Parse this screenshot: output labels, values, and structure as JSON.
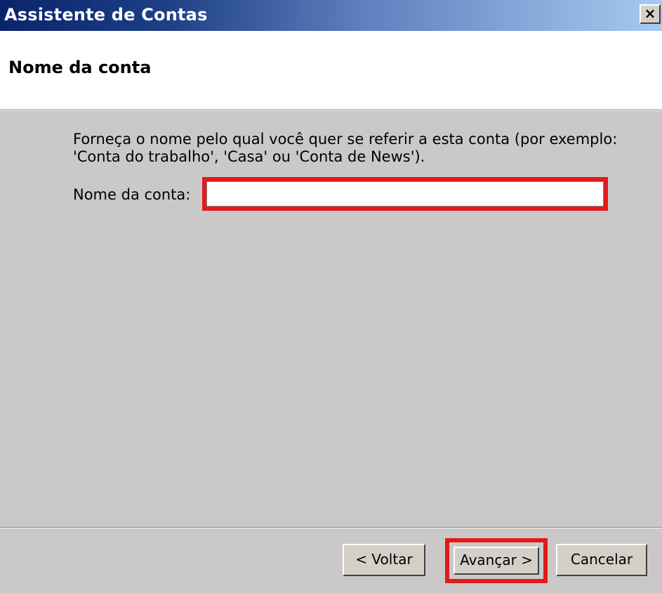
{
  "window": {
    "title": "Assistente de Contas",
    "close_symbol": "×"
  },
  "header": {
    "title": "Nome da conta"
  },
  "content": {
    "description": "Forneça o nome pelo qual você quer se referir a esta conta (por exemplo: 'Conta do trabalho', 'Casa' ou 'Conta de News').",
    "field_label": "Nome da conta:",
    "field_value": ""
  },
  "buttons": {
    "back": "< Voltar",
    "next": "Avançar >",
    "cancel": "Cancelar"
  },
  "colors": {
    "title_bar_start": "#0a246a",
    "title_bar_end": "#a6caf0",
    "highlight": "#e11b1b",
    "dialog_bg": "#cac8c8"
  },
  "icons": {
    "close": "close-icon"
  }
}
